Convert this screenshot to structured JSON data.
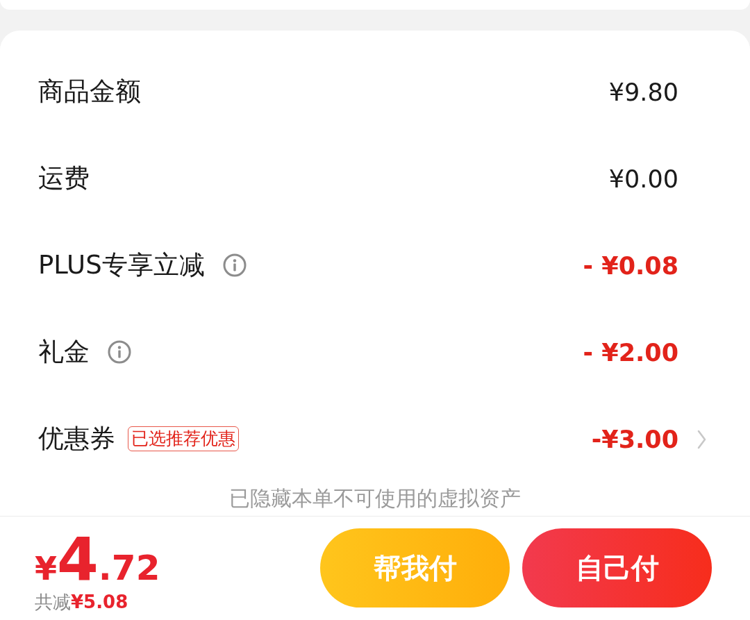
{
  "summary": {
    "rows": [
      {
        "label": "商品金额",
        "value": "¥9.80",
        "kind": "charge",
        "info": false,
        "tag": null,
        "chevron": false
      },
      {
        "label": "运费",
        "value": "¥0.00",
        "kind": "charge",
        "info": false,
        "tag": null,
        "chevron": false
      },
      {
        "label": "PLUS专享立减",
        "value": "- ¥0.08",
        "kind": "discount",
        "info": true,
        "tag": null,
        "chevron": false
      },
      {
        "label": "礼金",
        "value": "- ¥2.00",
        "kind": "discount",
        "info": true,
        "tag": null,
        "chevron": false
      },
      {
        "label": "优惠券",
        "value": "-¥3.00",
        "kind": "discount",
        "info": false,
        "tag": "已选推荐优惠",
        "chevron": true
      }
    ],
    "hidden_note": "已隐藏本单不可使用的虚拟资产"
  },
  "footer": {
    "total": {
      "currency": "¥",
      "integer": "4",
      "fraction": ".72"
    },
    "saved_label": "共减",
    "saved_amount": "¥5.08",
    "buttons": [
      {
        "label": "帮我付",
        "kind": "secondary"
      },
      {
        "label": "自己付",
        "kind": "primary"
      }
    ]
  }
}
